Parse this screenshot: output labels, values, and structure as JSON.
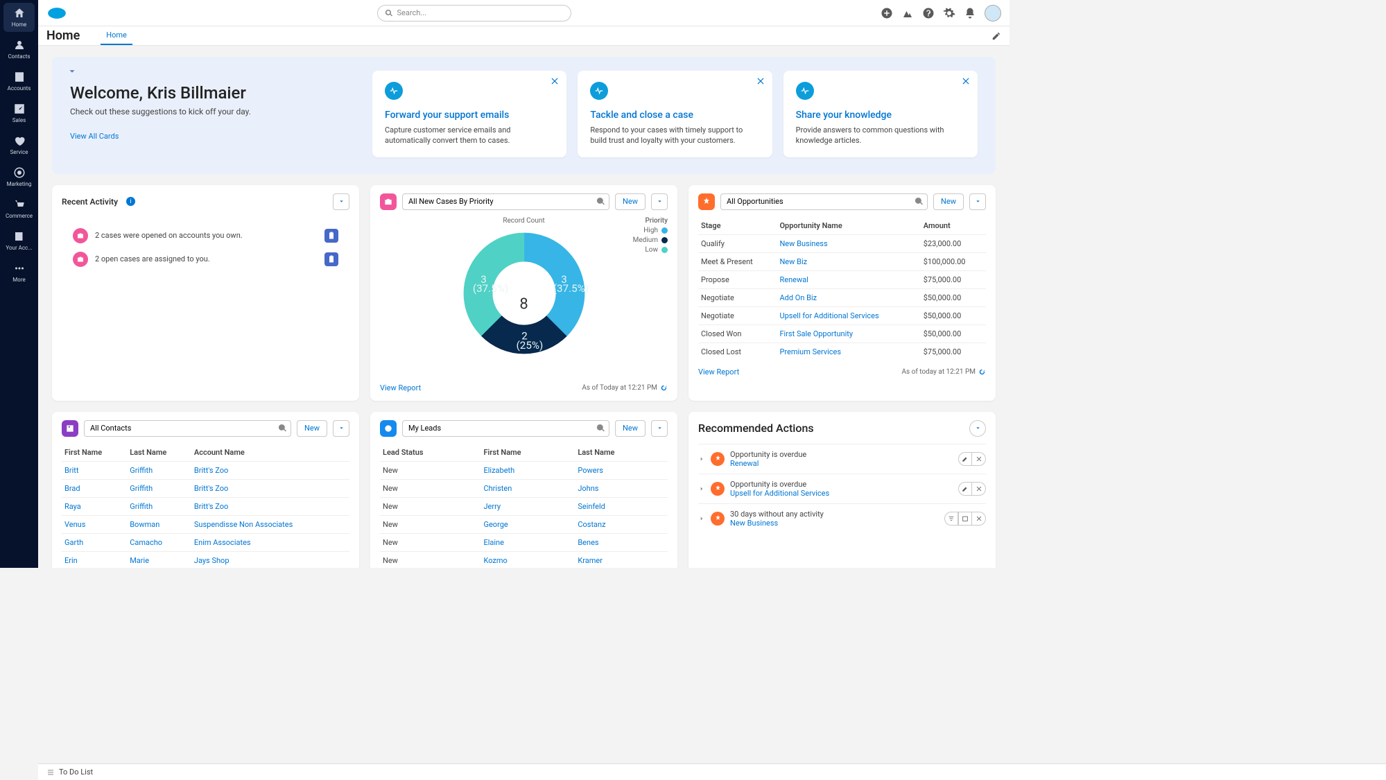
{
  "search_placeholder": "Search...",
  "sidebar": [
    {
      "label": "Home"
    },
    {
      "label": "Contacts"
    },
    {
      "label": "Accounts"
    },
    {
      "label": "Sales"
    },
    {
      "label": "Service"
    },
    {
      "label": "Marketing"
    },
    {
      "label": "Commerce"
    },
    {
      "label": "Your Acc..."
    },
    {
      "label": "More"
    }
  ],
  "page_title": "Home",
  "tab_home": "Home",
  "hero": {
    "title": "Welcome, Kris Billmaier",
    "subtitle": "Check out these suggestions to kick off your day.",
    "view_all": "View All Cards"
  },
  "suggestions": [
    {
      "title": "Forward your support emails",
      "desc": "Capture customer service emails and automatically convert them to cases."
    },
    {
      "title": "Tackle and close a case",
      "desc": "Respond to your cases with timely support to build trust and loyalty with your customers."
    },
    {
      "title": "Share your knowledge",
      "desc": "Provide answers to common questions with knowledge articles."
    }
  ],
  "recent": {
    "title": "Recent Activity",
    "items": [
      "2 cases were opened on accounts you own.",
      "2 open cases are assigned to you."
    ]
  },
  "cases": {
    "filter": "All New Cases By Priority",
    "new_btn": "New",
    "record_count_label": "Record Count",
    "priority_label": "Priority",
    "view_report": "View Report",
    "timestamp": "As of Today at 12:21 PM",
    "center": "8"
  },
  "chart_data": {
    "type": "pie",
    "title": "Record Count",
    "series": [
      {
        "name": "High",
        "value": 3,
        "pct": "(37.5%)",
        "color": "#36b5e6"
      },
      {
        "name": "Medium",
        "value": 2,
        "pct": "(25%)",
        "color": "#06294d"
      },
      {
        "name": "Low",
        "value": 3,
        "pct": "(37.5%)",
        "color": "#4fd1c5"
      }
    ],
    "total": 8
  },
  "opps": {
    "filter": "All Opportunities",
    "new_btn": "New",
    "cols": {
      "stage": "Stage",
      "name": "Opportunity Name",
      "amount": "Amount"
    },
    "rows": [
      {
        "stage": "Qualify",
        "name": "New Business",
        "amount": "$23,000.00"
      },
      {
        "stage": "Meet & Present",
        "name": "New Biz",
        "amount": "$100,000.00"
      },
      {
        "stage": "Propose",
        "name": "Renewal",
        "amount": "$75,000.00"
      },
      {
        "stage": "Negotiate",
        "name": "Add On Biz",
        "amount": "$50,000.00"
      },
      {
        "stage": "Negotiate",
        "name": "Upsell for Additional Services",
        "amount": "$50,000.00"
      },
      {
        "stage": "Closed Won",
        "name": "First Sale Opportunity",
        "amount": "$50,000.00"
      },
      {
        "stage": "Closed Lost",
        "name": "Premium Services",
        "amount": "$75,000.00"
      }
    ],
    "view_report": "View Report",
    "timestamp": "As of today at 12:21 PM"
  },
  "contacts": {
    "filter": "All Contacts",
    "new_btn": "New",
    "cols": {
      "fn": "First Name",
      "ln": "Last Name",
      "acc": "Account Name"
    },
    "rows": [
      {
        "fn": "Britt",
        "ln": "Griffith",
        "acc": "Britt's Zoo"
      },
      {
        "fn": "Brad",
        "ln": "Griffith",
        "acc": "Britt's Zoo"
      },
      {
        "fn": "Raya",
        "ln": "Griffith",
        "acc": "Britt's Zoo"
      },
      {
        "fn": "Venus",
        "ln": "Bowman",
        "acc": "Suspendisse Non Associates"
      },
      {
        "fn": "Garth",
        "ln": "Camacho",
        "acc": "Enim Associates"
      },
      {
        "fn": "Erin",
        "ln": "Marie",
        "acc": "Jays Shop"
      }
    ]
  },
  "leads": {
    "filter": "My Leads",
    "new_btn": "New",
    "cols": {
      "status": "Lead Status",
      "fn": "First Name",
      "ln": "Last Name"
    },
    "rows": [
      {
        "status": "New",
        "fn": "Elizabeth",
        "ln": "Powers"
      },
      {
        "status": "New",
        "fn": "Christen",
        "ln": "Johns"
      },
      {
        "status": "New",
        "fn": "Jerry",
        "ln": "Seinfeld"
      },
      {
        "status": "New",
        "fn": "George",
        "ln": "Costanz"
      },
      {
        "status": "New",
        "fn": "Elaine",
        "ln": "Benes"
      },
      {
        "status": "New",
        "fn": "Kozmo",
        "ln": "Kramer"
      }
    ]
  },
  "rec": {
    "title": "Recommended Actions",
    "items": [
      {
        "t1": "Opportunity is overdue",
        "t2": "Renewal"
      },
      {
        "t1": "Opportunity is overdue",
        "t2": "Upsell for Additional Services"
      },
      {
        "t1": "30 days without any activity",
        "t2": "New Business"
      }
    ]
  },
  "todo": "To Do List"
}
